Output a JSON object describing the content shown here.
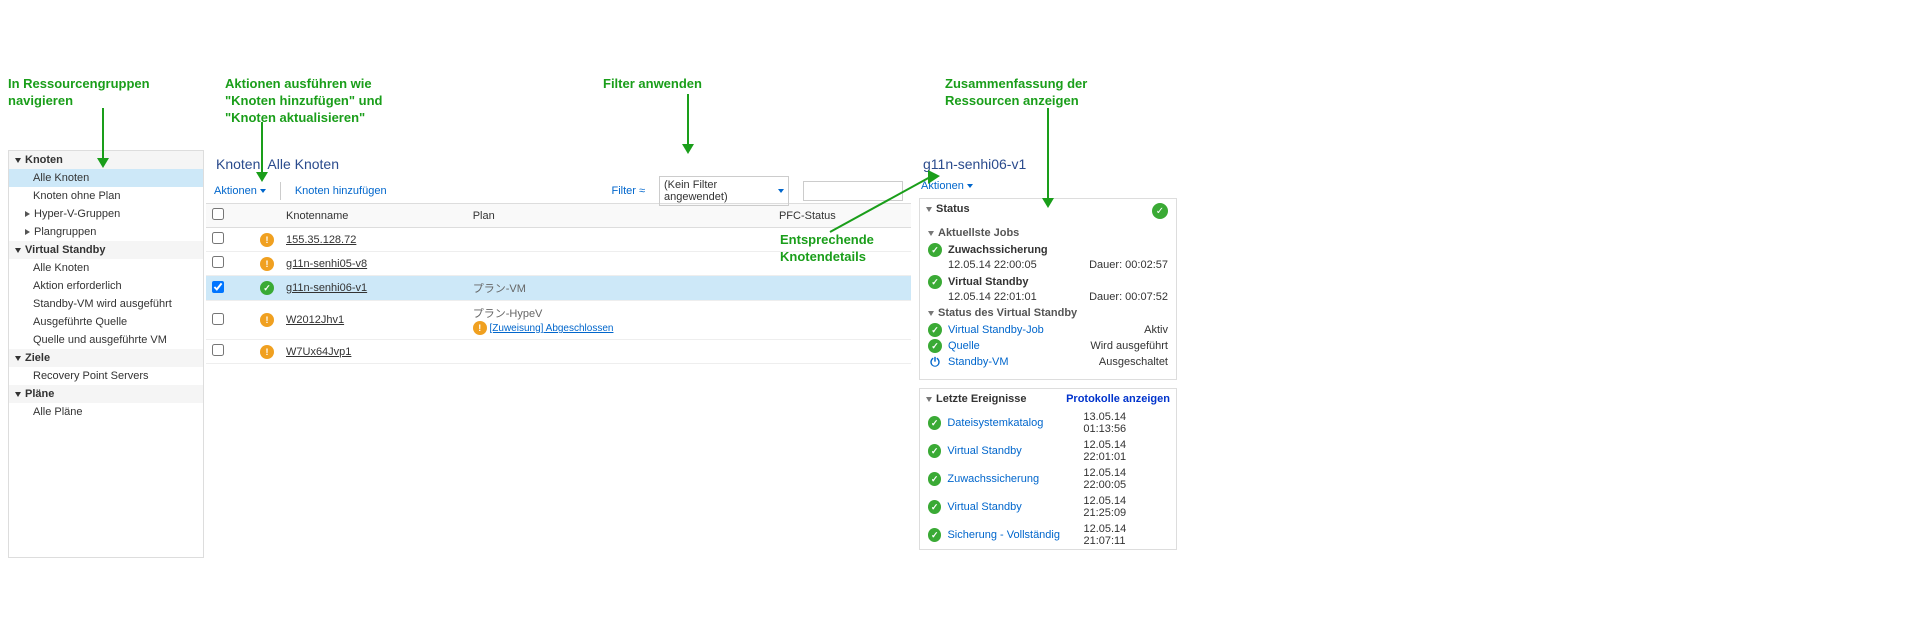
{
  "annotations": {
    "nav": "In Ressourcengruppen\nnavigieren",
    "actions": "Aktionen ausführen wie\n\"Knoten hinzufügen\" und\n\"Knoten aktualisieren\"",
    "filter": "Filter anwenden",
    "details": "Entsprechende\nKnotendetails",
    "summary": "Zusammenfassung der\nRessourcen anzeigen"
  },
  "nav": {
    "groups": [
      {
        "label": "Knoten",
        "items": [
          {
            "label": "Alle Knoten",
            "selected": true
          },
          {
            "label": "Knoten ohne Plan"
          },
          {
            "label": "Hyper-V-Gruppen",
            "hasChildren": true
          },
          {
            "label": "Plangruppen",
            "hasChildren": true
          }
        ]
      },
      {
        "label": "Virtual Standby",
        "items": [
          {
            "label": "Alle Knoten"
          },
          {
            "label": "Aktion erforderlich"
          },
          {
            "label": "Standby-VM wird ausgeführt"
          },
          {
            "label": "Ausgeführte Quelle"
          },
          {
            "label": "Quelle und ausgeführte VM"
          }
        ]
      },
      {
        "label": "Ziele",
        "items": [
          {
            "label": "Recovery Point Servers"
          }
        ]
      },
      {
        "label": "Pläne",
        "items": [
          {
            "label": "Alle Pläne"
          }
        ]
      }
    ]
  },
  "center": {
    "title_prefix": "Knoten:",
    "title_value": "Alle Knoten",
    "toolbar": {
      "actions": "Aktionen",
      "add_node": "Knoten hinzufügen",
      "filter": "Filter",
      "filter_dd": "(Kein Filter angewendet)",
      "search_placeholder": ""
    },
    "columns": {
      "name": "Knotenname",
      "plan": "Plan",
      "pfc": "PFC-Status"
    },
    "rows": [
      {
        "status": "warn",
        "name": "155.35.128.72",
        "plan": "",
        "pfc": "",
        "selected": false
      },
      {
        "status": "warn",
        "name": "g11n-senhi05-v8",
        "plan": "",
        "pfc": "",
        "selected": false
      },
      {
        "status": "ok",
        "name": "g11n-senhi06-v1",
        "plan": "プラン-VM",
        "pfc": "",
        "selected": true
      },
      {
        "status": "warn",
        "name": "W2012Jhv1",
        "plan": "プラン-HypeV",
        "assign": "[Zuweisung] Abgeschlossen",
        "pfc": "",
        "selected": false
      },
      {
        "status": "warn",
        "name": "W7Ux64Jvp1",
        "plan": "",
        "pfc": "",
        "selected": false
      }
    ]
  },
  "details": {
    "title": "g11n-senhi06-v1",
    "actions": "Aktionen",
    "status": {
      "header": "Status",
      "latest_jobs_header": "Aktuellste Jobs",
      "jobs": [
        {
          "name": "Zuwachssicherung",
          "time": "12.05.14 22:00:05",
          "dur_label": "Dauer:",
          "dur": "00:02:57"
        },
        {
          "name": "Virtual Standby",
          "time": "12.05.14 22:01:01",
          "dur_label": "Dauer:",
          "dur": "00:07:52"
        }
      ],
      "vs_header": "Status des Virtual Standby",
      "vs": [
        {
          "icon": "ok",
          "k": "Virtual Standby-Job",
          "v": "Aktiv"
        },
        {
          "icon": "ok",
          "k": "Quelle",
          "v": "Wird ausgeführt"
        },
        {
          "icon": "power",
          "k": "Standby-VM",
          "v": "Ausgeschaltet"
        }
      ]
    },
    "events": {
      "header": "Letzte Ereignisse",
      "link": "Protokolle anzeigen",
      "rows": [
        {
          "name": "Dateisystemkatalog",
          "time": "13.05.14 01:13:56"
        },
        {
          "name": "Virtual Standby",
          "time": "12.05.14 22:01:01"
        },
        {
          "name": "Zuwachssicherung",
          "time": "12.05.14 22:00:05"
        },
        {
          "name": "Virtual Standby",
          "time": "12.05.14 21:25:09"
        },
        {
          "name": "Sicherung - Vollständig",
          "time": "12.05.14 21:07:11"
        }
      ]
    }
  }
}
